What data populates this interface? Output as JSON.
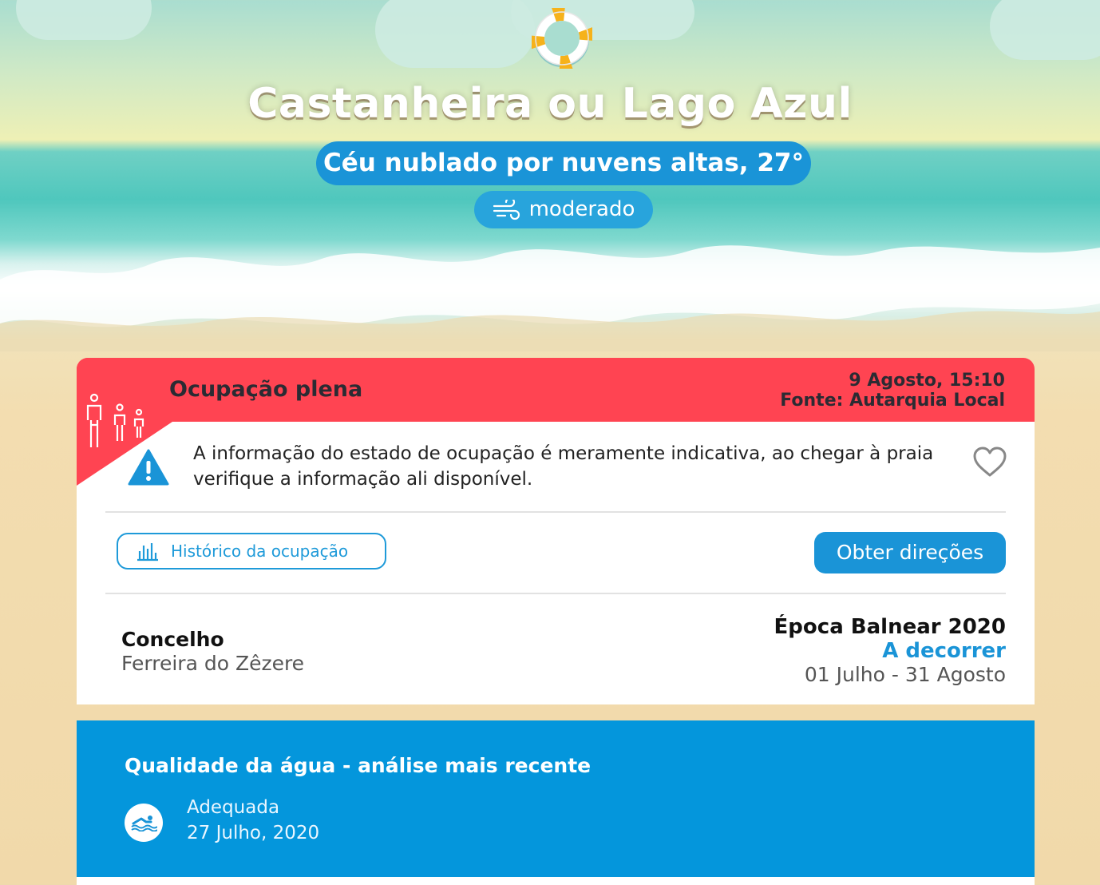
{
  "beach": {
    "name": "Castanheira ou Lago Azul",
    "weather": "Céu nublado por nuvens altas, 27°",
    "wind": "moderado"
  },
  "occupancy": {
    "status": "Ocupação plena",
    "date": "9 Agosto, 15:10",
    "source": "Fonte: Autarquia Local",
    "disclaimer": "A informação do estado de ocupação é meramente indicativa, ao chegar à praia verifique a informação ali disponível.",
    "history_label": "Histórico da ocupação",
    "directions_label": "Obter direções",
    "color": "#ff4452"
  },
  "location": {
    "concelho_label": "Concelho",
    "concelho_value": "Ferreira do Zêzere"
  },
  "season": {
    "title": "Época Balnear 2020",
    "status": "A decorrer",
    "dates": "01 Julho - 31 Agosto"
  },
  "water_quality": {
    "title": "Qualidade da água - análise mais recente",
    "status": "Adequada",
    "date": "27 Julho, 2020",
    "color": "#0496dc"
  },
  "icons": [
    "lifebuoy-icon",
    "wind-icon",
    "people-icon",
    "warning-icon",
    "heart-icon",
    "bar-chart-icon",
    "swimmer-icon"
  ],
  "accent": "#1a94d7"
}
